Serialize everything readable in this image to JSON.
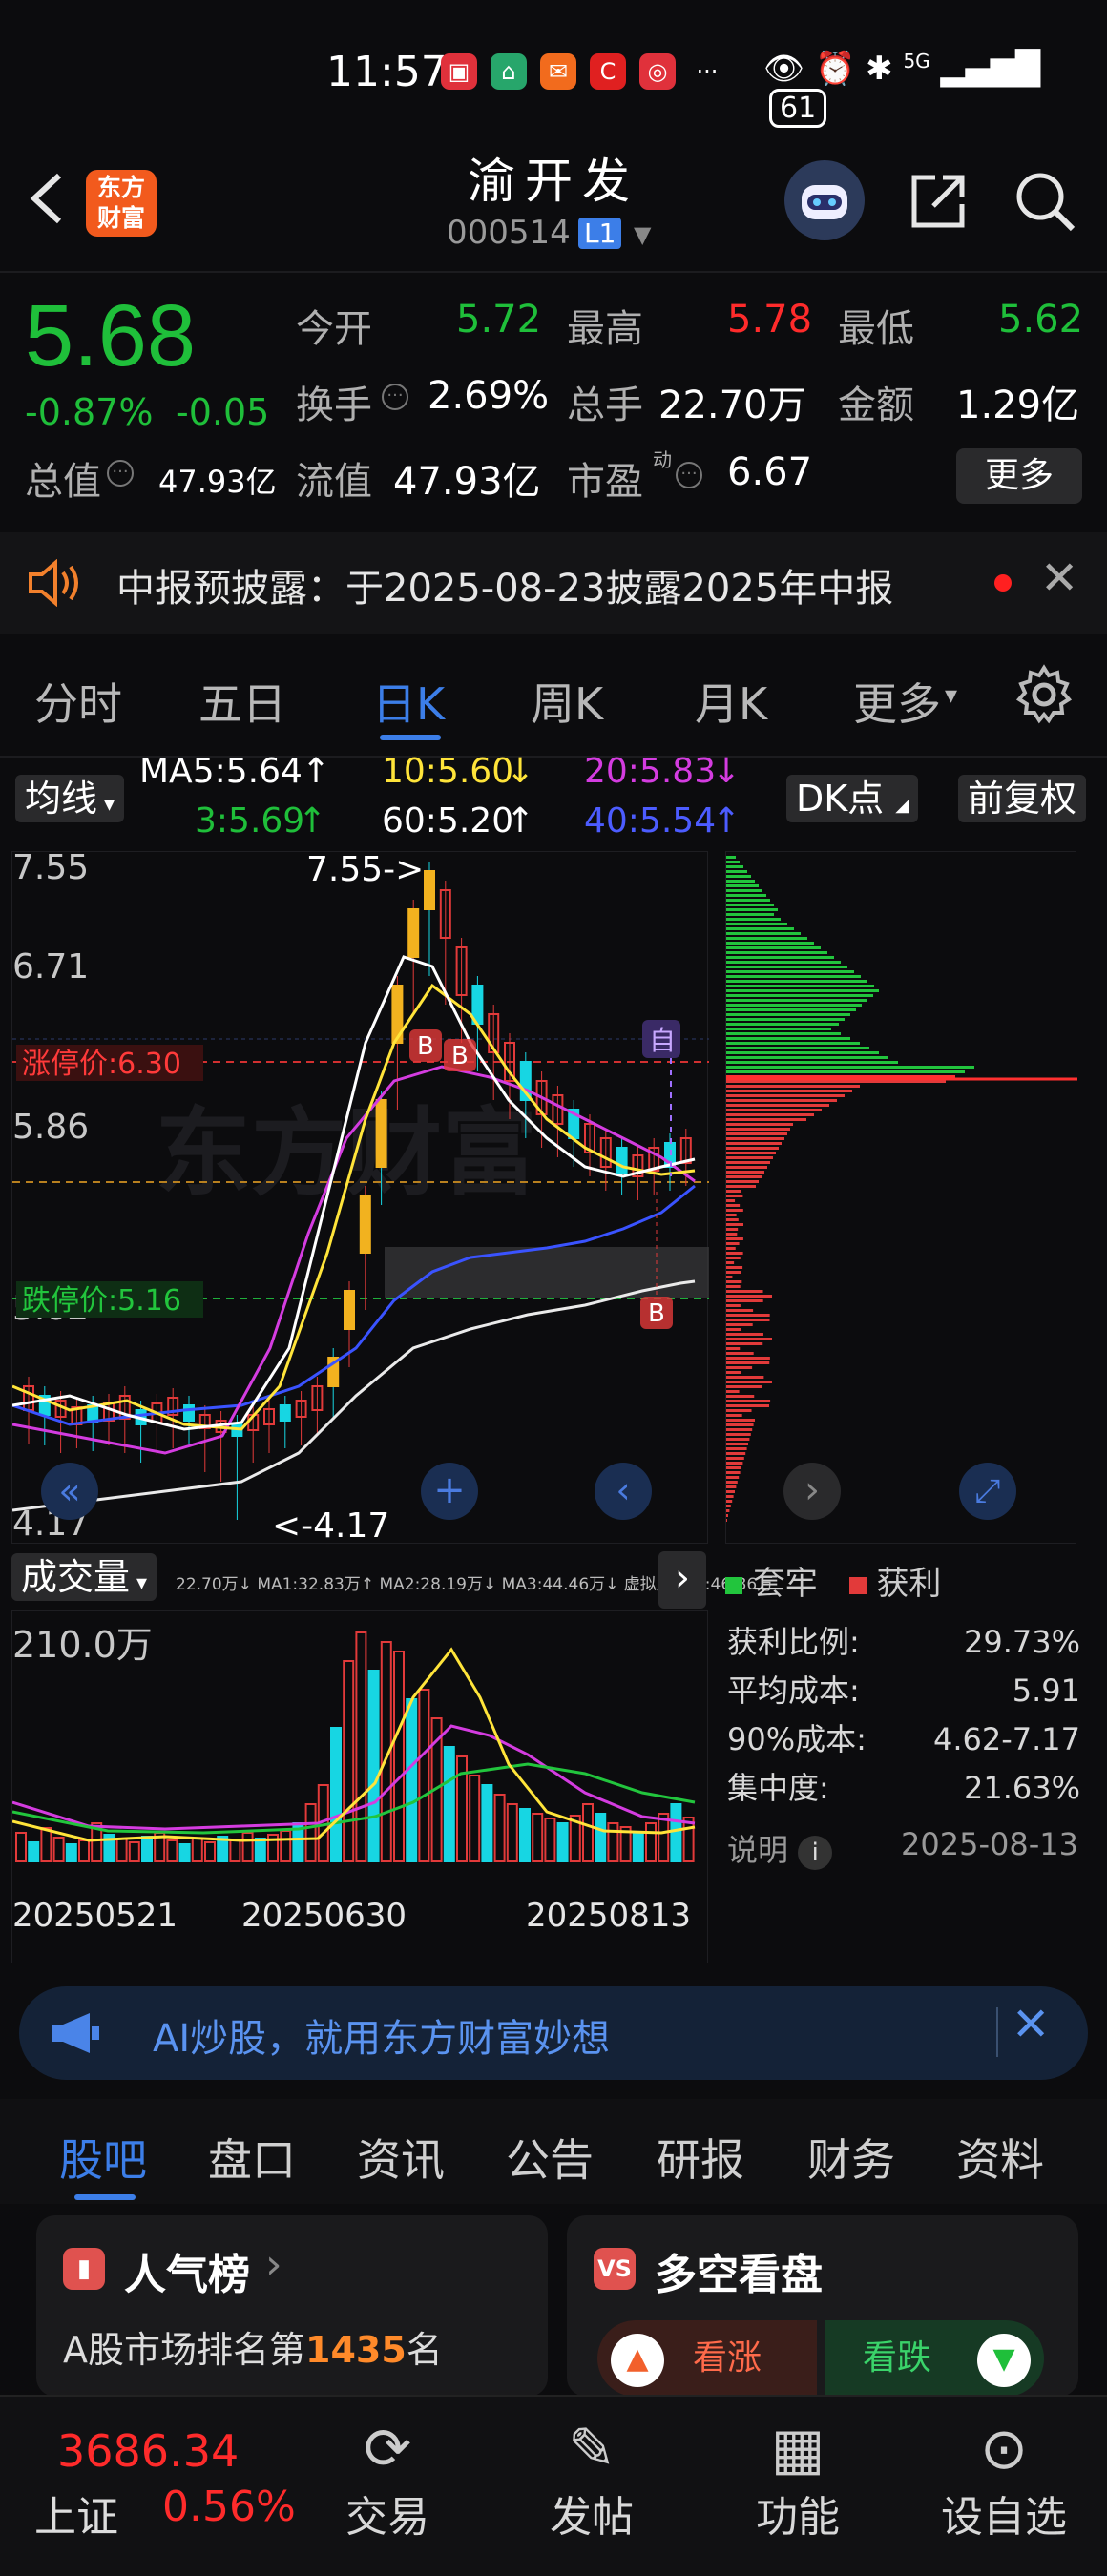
{
  "status": {
    "time": "11:57",
    "battery": "61",
    "network": "5G"
  },
  "header": {
    "title": "渝开发",
    "code": "000514",
    "level_badge": "L1",
    "logo_line1": "东方",
    "logo_line2": "财富"
  },
  "quote": {
    "price": "5.68",
    "change_pct": "-0.87%",
    "change": "-0.05",
    "open_label": "今开",
    "open": "5.72",
    "high_label": "最高",
    "high": "5.78",
    "low_label": "最低",
    "low": "5.62",
    "turnover_label": "换手",
    "turnover": "2.69%",
    "volume_label": "总手",
    "volume": "22.70万",
    "amount_label": "金额",
    "amount": "1.29亿",
    "mktcap_label": "总值",
    "mktcap": "47.93亿",
    "float_label": "流值",
    "float_cap": "47.93亿",
    "pe_label": "市盈",
    "pe_sup": "动",
    "pe": "6.67",
    "more_label": "更多"
  },
  "notice": {
    "text": "中报预披露：于2025-08-23披露2025年中报"
  },
  "chart_tabs": [
    "分时",
    "五日",
    "日K",
    "周K",
    "月K",
    "更多"
  ],
  "active_tab": "日K",
  "ma_bar": {
    "selector": "均线",
    "ma5": "MA5:5.64",
    "ma10": "10:5.60",
    "ma20": "20:5.83",
    "ma3": "3:5.69",
    "ma60": "60:5.20",
    "ma40": "40:5.54",
    "dk_label": "DK点",
    "adj_label": "前复权"
  },
  "kchart": {
    "y_labels": [
      "7.55",
      "6.71",
      "5.86",
      "5.02",
      "4.17"
    ],
    "high_note": "7.55->",
    "low_note": "<-4.17",
    "limit_up": "涨停价:6.30",
    "limit_down": "跌停价:5.16",
    "markers": [
      "B",
      "B",
      "B",
      "自"
    ],
    "watermark": "东方财富"
  },
  "volume_panel": {
    "selector": "成交量",
    "legend": "22.70万↓ MA1:32.83万↑ MA2:28.19万↓ MA3:44.46万↓ 虚拟成交量:46.86万",
    "y_max": "210.0万",
    "dates": [
      "20250521",
      "20250630",
      "20250813"
    ]
  },
  "chips": {
    "trapped_label": "套牢",
    "profit_label": "获利",
    "rows": [
      {
        "label": "获利比例:",
        "value": "29.73%"
      },
      {
        "label": "平均成本:",
        "value": "5.91"
      },
      {
        "label": "90%成本:",
        "value": "4.62-7.17"
      },
      {
        "label": "集中度:",
        "value": "21.63%"
      }
    ],
    "note_label": "说明",
    "date": "2025-08-13"
  },
  "ai_banner": {
    "text": "AI炒股，就用东方财富妙想"
  },
  "content_tabs": [
    "股吧",
    "盘口",
    "资讯",
    "公告",
    "研报",
    "财务",
    "资料"
  ],
  "content_active": "股吧",
  "cards": {
    "popularity_title": "人气榜",
    "popularity_line": "A股市场排名第",
    "rank": "1435",
    "rank_unit": "名",
    "duokong_title": "多空看盘",
    "bull_label": "看涨",
    "bear_label": "看跌"
  },
  "dock": {
    "index_value": "3686.34",
    "index_name": "上证",
    "index_pct": "0.56%",
    "items": [
      "交易",
      "发帖",
      "功能",
      "设自选"
    ]
  },
  "colors": {
    "up": "#ff2b2b",
    "down": "#1fbf3a",
    "accent": "#3c7ee8",
    "brand": "#f25a1d"
  }
}
